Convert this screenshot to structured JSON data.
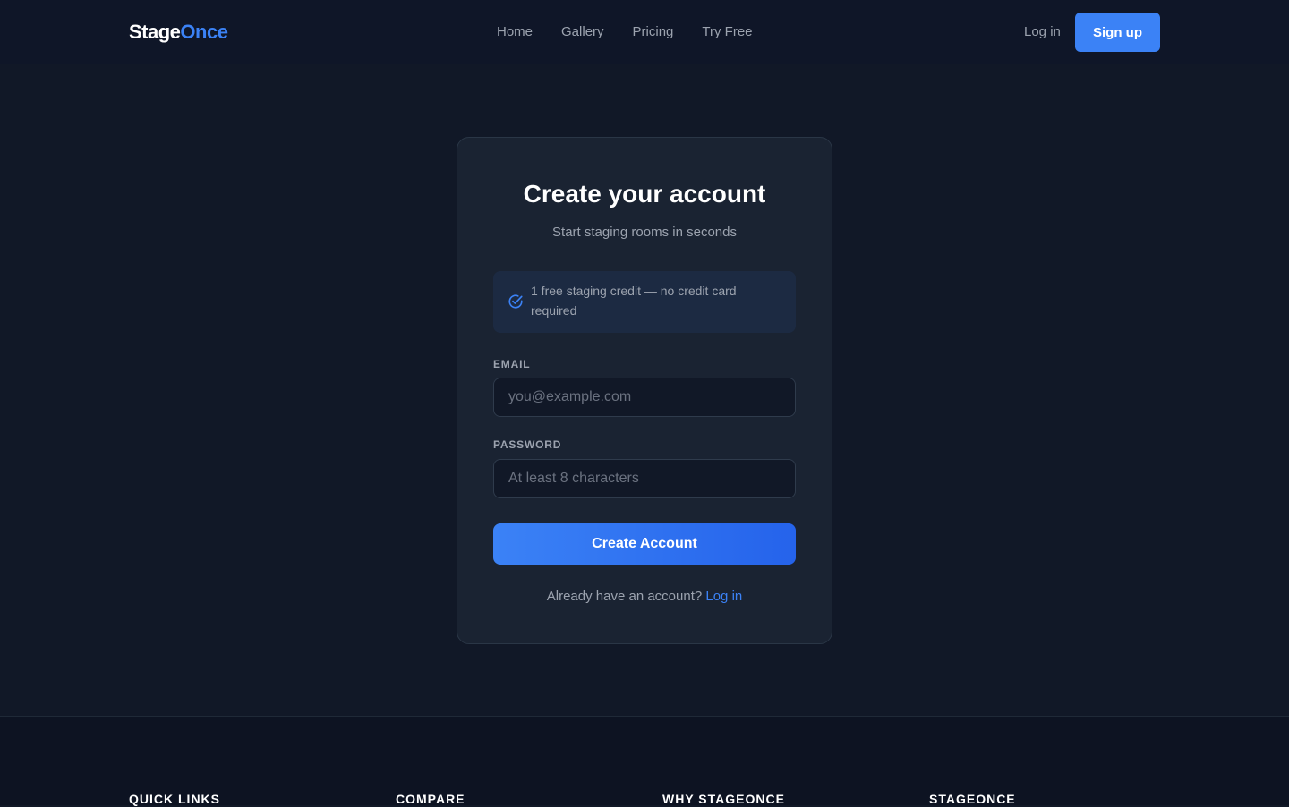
{
  "header": {
    "logo_main": "Stage",
    "logo_accent": "Once",
    "nav": [
      "Home",
      "Gallery",
      "Pricing",
      "Try Free"
    ],
    "login_label": "Log in",
    "signup_label": "Sign up"
  },
  "card": {
    "title": "Create your account",
    "subtitle": "Start staging rooms in seconds",
    "notice": "1 free staging credit — no credit card required",
    "email_label": "EMAIL",
    "email_placeholder": "you@example.com",
    "password_label": "PASSWORD",
    "password_placeholder": "At least 8 characters",
    "submit_label": "Create Account",
    "already_text": "Already have an account?",
    "login_link": "Log in"
  },
  "footer": {
    "headings": [
      "QUICK LINKS",
      "COMPARE",
      "WHY STAGEONCE",
      "STAGEONCE"
    ]
  },
  "colors": {
    "accent": "#3b82f6",
    "background": "#111827",
    "card": "#1a2332"
  }
}
